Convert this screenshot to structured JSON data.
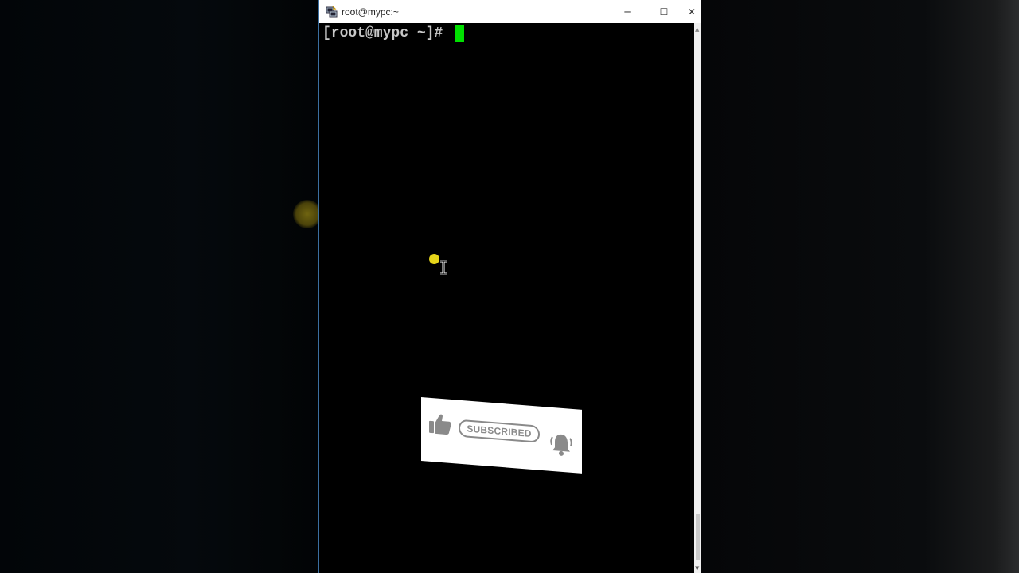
{
  "window": {
    "title": "root@mypc:~",
    "controls": {
      "minimize": "─",
      "maximize": "☐",
      "close": "✕"
    }
  },
  "terminal": {
    "prompt": "[root@mypc ~]# ",
    "cursor_color": "#00e000",
    "text_color": "#c8c8c8",
    "background": "#000000"
  },
  "overlay": {
    "subscribe_label": "SUBSCRIBED",
    "icons": [
      "thumbs-up-icon",
      "bell-icon"
    ]
  },
  "colors": {
    "pointer_highlight": "#e6d51a",
    "overlay_grey": "#8a8a8a"
  }
}
